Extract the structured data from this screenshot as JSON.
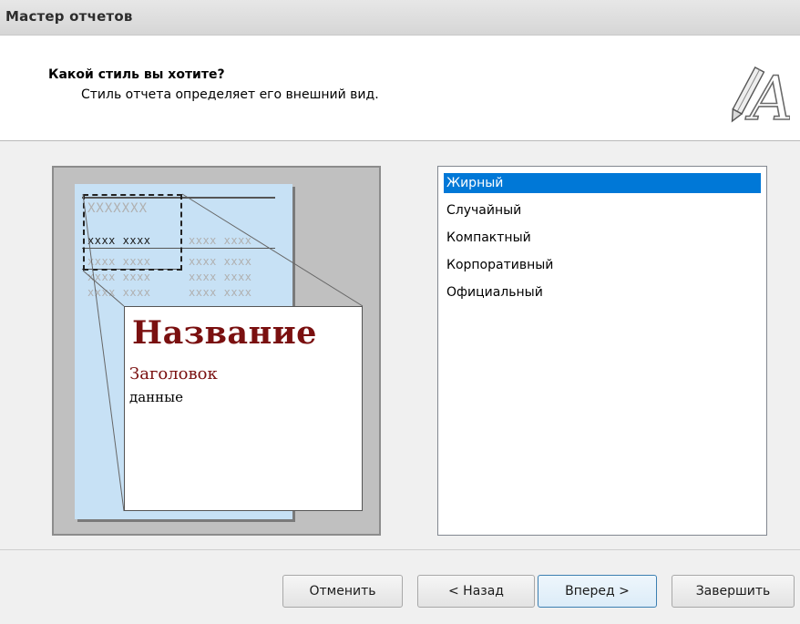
{
  "window": {
    "title": "Мастер отчетов"
  },
  "header": {
    "title": "Какой стиль вы хотите?",
    "subtitle": "Стиль отчета определяет его внешний вид.",
    "icon": "pencil-letter-a-icon"
  },
  "preview": {
    "masked_header": "XXXXXXX",
    "row_left_dark": "xxxx xxxx",
    "row_right": "xxxx xxxx",
    "row_left_light": "xxxx xxxx",
    "zoom_title": "Название",
    "zoom_heading": "Заголовок",
    "zoom_data": "данные"
  },
  "styles": {
    "items": [
      {
        "label": "Жирный",
        "selected": true
      },
      {
        "label": "Случайный",
        "selected": false
      },
      {
        "label": "Компактный",
        "selected": false
      },
      {
        "label": "Корпоративный",
        "selected": false
      },
      {
        "label": "Официальный",
        "selected": false
      }
    ],
    "selection_color": "#0078d7"
  },
  "buttons": {
    "cancel": "Отменить",
    "back": "< Назад",
    "next": "Вперед >",
    "finish": "Завершить"
  }
}
